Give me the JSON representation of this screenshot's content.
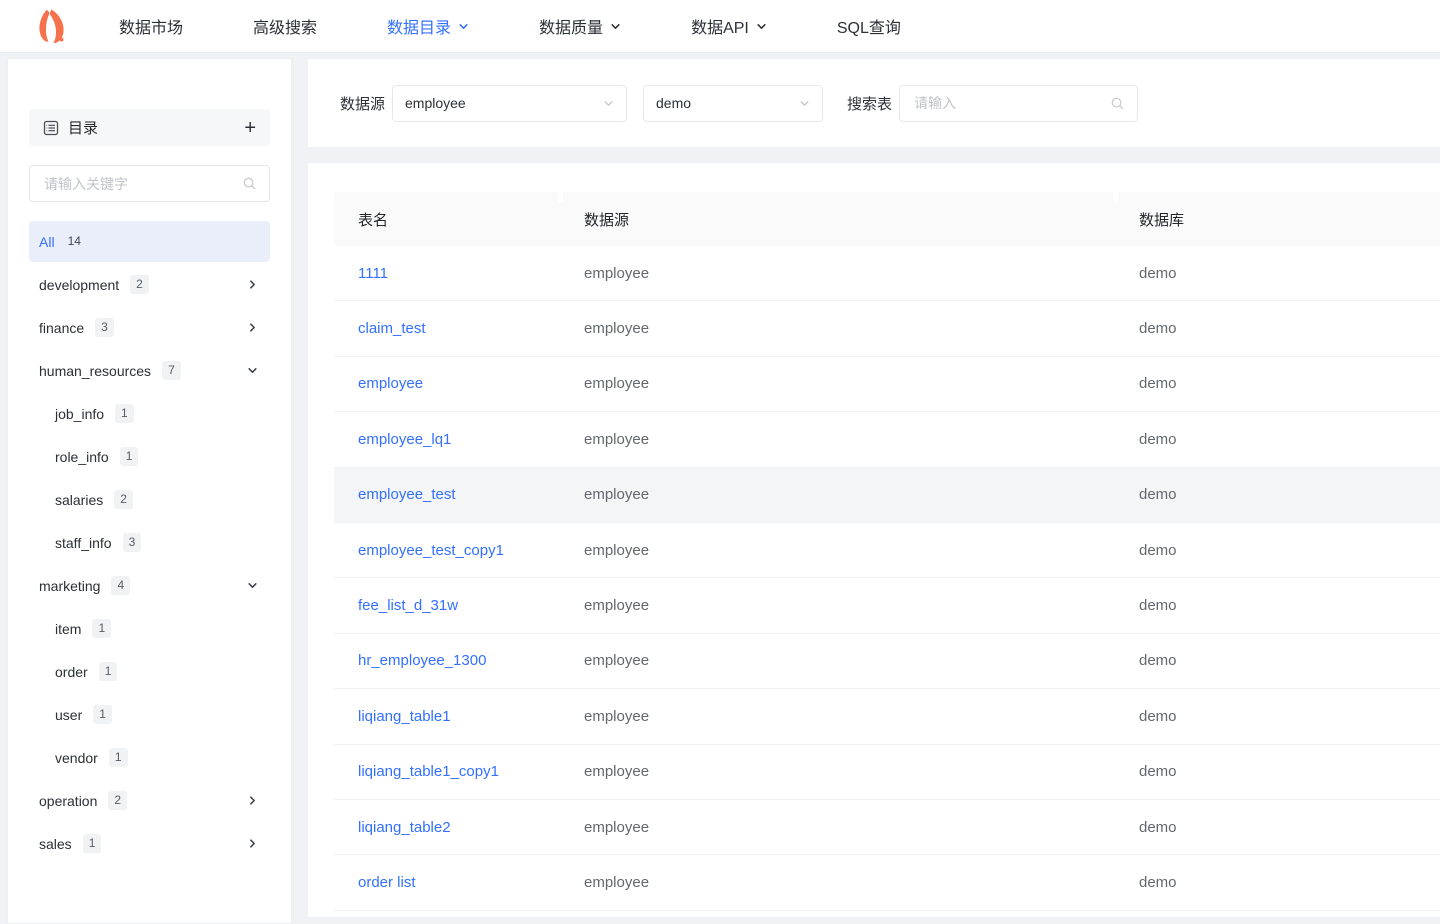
{
  "nav": {
    "items": [
      {
        "label": "数据市场",
        "active": false,
        "dropdown": false
      },
      {
        "label": "高级搜索",
        "active": false,
        "dropdown": false
      },
      {
        "label": "数据目录",
        "active": true,
        "dropdown": true
      },
      {
        "label": "数据质量",
        "active": false,
        "dropdown": true
      },
      {
        "label": "数据API",
        "active": false,
        "dropdown": true
      },
      {
        "label": "SQL查询",
        "active": false,
        "dropdown": false
      }
    ]
  },
  "sidebar": {
    "title": "目录",
    "add_button": "+",
    "search_placeholder": "请输入关键字",
    "tree": [
      {
        "label": "All",
        "count": "14",
        "level": 0,
        "selected": true,
        "chevron": ""
      },
      {
        "label": "development",
        "count": "2",
        "level": 0,
        "selected": false,
        "chevron": "right"
      },
      {
        "label": "finance",
        "count": "3",
        "level": 0,
        "selected": false,
        "chevron": "right"
      },
      {
        "label": "human_resources",
        "count": "7",
        "level": 0,
        "selected": false,
        "chevron": "down"
      },
      {
        "label": "job_info",
        "count": "1",
        "level": 1,
        "selected": false,
        "chevron": ""
      },
      {
        "label": "role_info",
        "count": "1",
        "level": 1,
        "selected": false,
        "chevron": ""
      },
      {
        "label": "salaries",
        "count": "2",
        "level": 1,
        "selected": false,
        "chevron": ""
      },
      {
        "label": "staff_info",
        "count": "3",
        "level": 1,
        "selected": false,
        "chevron": ""
      },
      {
        "label": "marketing",
        "count": "4",
        "level": 0,
        "selected": false,
        "chevron": "down"
      },
      {
        "label": "item",
        "count": "1",
        "level": 1,
        "selected": false,
        "chevron": ""
      },
      {
        "label": "order",
        "count": "1",
        "level": 1,
        "selected": false,
        "chevron": ""
      },
      {
        "label": "user",
        "count": "1",
        "level": 1,
        "selected": false,
        "chevron": ""
      },
      {
        "label": "vendor",
        "count": "1",
        "level": 1,
        "selected": false,
        "chevron": ""
      },
      {
        "label": "operation",
        "count": "2",
        "level": 0,
        "selected": false,
        "chevron": "right"
      },
      {
        "label": "sales",
        "count": "1",
        "level": 0,
        "selected": false,
        "chevron": "right"
      }
    ]
  },
  "filters": {
    "datasource_label": "数据源",
    "datasource_value": "employee",
    "database_value": "demo",
    "search_label": "搜索表",
    "search_placeholder": "请输入"
  },
  "table": {
    "columns": [
      "表名",
      "数据源",
      "数据库"
    ],
    "highlighted_row": "employee_test",
    "rows": [
      {
        "name": "1111",
        "source": "employee",
        "db": "demo",
        "highlighted": false
      },
      {
        "name": "claim_test",
        "source": "employee",
        "db": "demo",
        "highlighted": false
      },
      {
        "name": "employee",
        "source": "employee",
        "db": "demo",
        "highlighted": false
      },
      {
        "name": "employee_lq1",
        "source": "employee",
        "db": "demo",
        "highlighted": false
      },
      {
        "name": "employee_test",
        "source": "employee",
        "db": "demo",
        "highlighted": true
      },
      {
        "name": "employee_test_copy1",
        "source": "employee",
        "db": "demo",
        "highlighted": false
      },
      {
        "name": "fee_list_d_31w",
        "source": "employee",
        "db": "demo",
        "highlighted": false
      },
      {
        "name": "hr_employee_1300",
        "source": "employee",
        "db": "demo",
        "highlighted": false
      },
      {
        "name": "liqiang_table1",
        "source": "employee",
        "db": "demo",
        "highlighted": false
      },
      {
        "name": "liqiang_table1_copy1",
        "source": "employee",
        "db": "demo",
        "highlighted": false
      },
      {
        "name": "liqiang_table2",
        "source": "employee",
        "db": "demo",
        "highlighted": false
      },
      {
        "name": "order list",
        "source": "employee",
        "db": "demo",
        "highlighted": false
      }
    ]
  },
  "colors": {
    "accent_blue": "#3370ff",
    "logo_orange": "#f5724d",
    "selected_row_bg": "#eaeefa",
    "table_header_bg": "#fafafa",
    "highlight_row_bg": "#f4f5f7",
    "secondary_text": "#63676e"
  }
}
